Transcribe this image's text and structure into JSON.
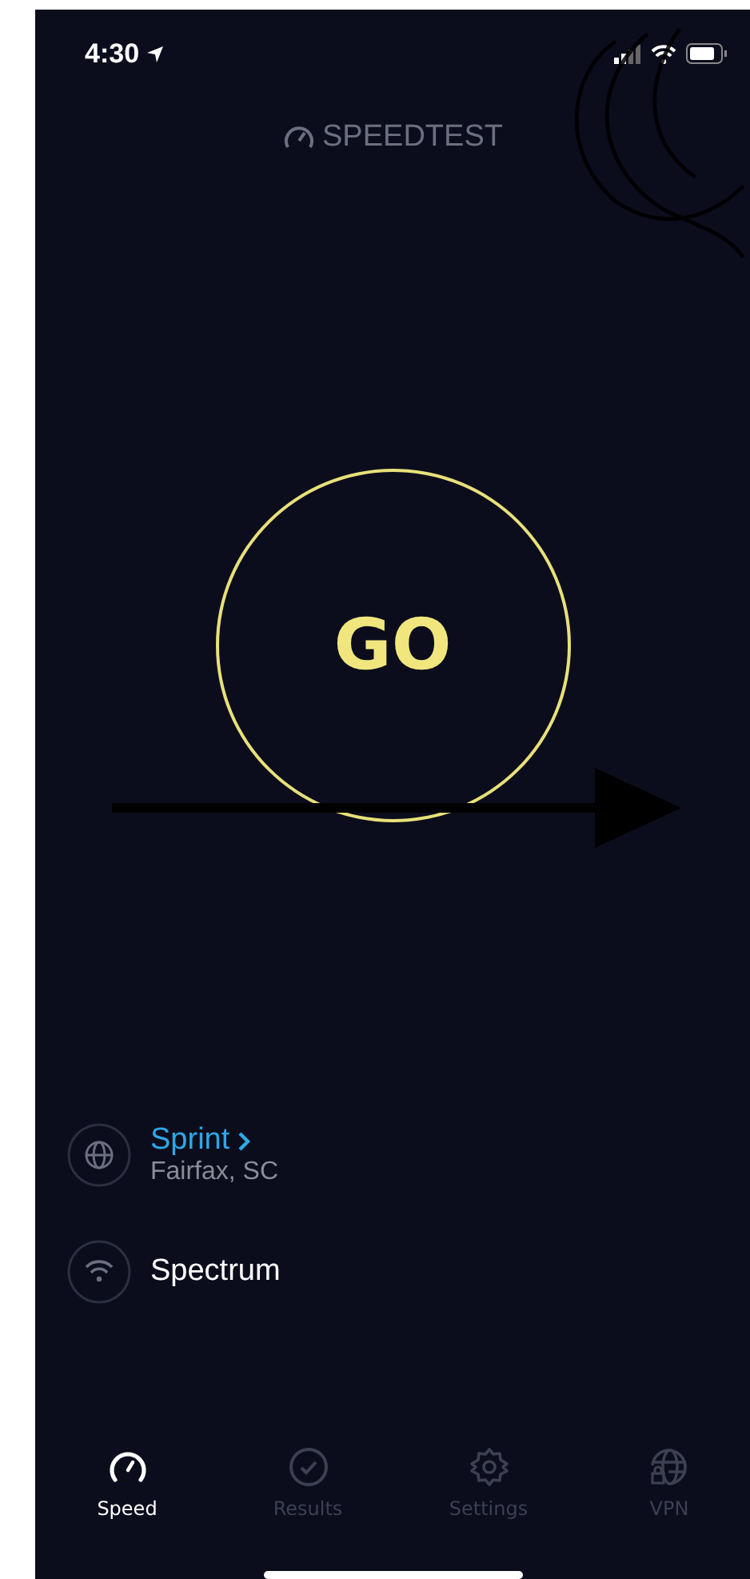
{
  "status_bar": {
    "time": "4:30"
  },
  "header": {
    "logo": "SPEEDTEST"
  },
  "go_button": {
    "label": "GO"
  },
  "connections": [
    {
      "kind": "server",
      "name": "Sprint",
      "detail": "Fairfax, SC",
      "link": true
    },
    {
      "kind": "wifi",
      "name": "Spectrum",
      "link": false
    }
  ],
  "tabs": [
    {
      "kind": "speed",
      "label": "Speed",
      "selected": true
    },
    {
      "kind": "results",
      "label": "Results",
      "selected": false
    },
    {
      "kind": "settings",
      "label": "Settings",
      "selected": false
    },
    {
      "kind": "vpn",
      "label": "VPN",
      "selected": false
    }
  ]
}
